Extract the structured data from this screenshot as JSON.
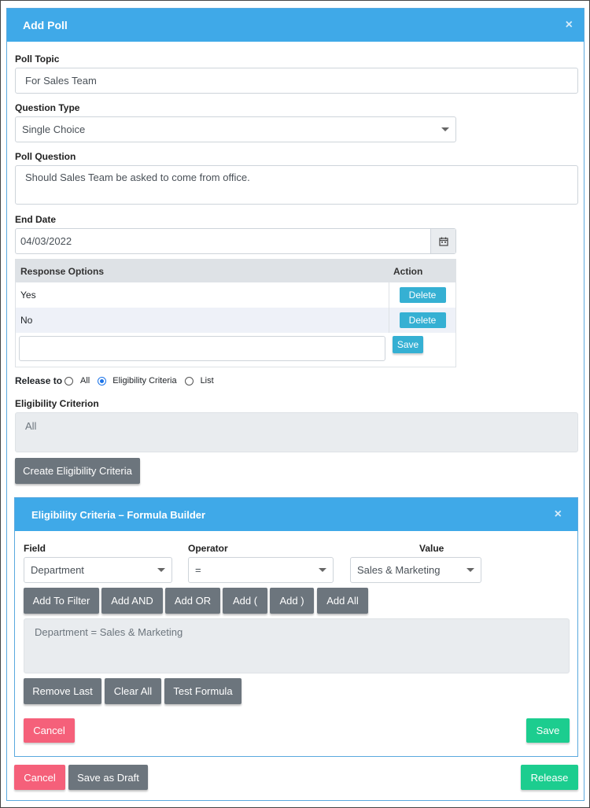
{
  "modal": {
    "title": "Add Poll",
    "close": "×"
  },
  "poll_topic": {
    "label": "Poll Topic",
    "value": "For Sales Team"
  },
  "question_type": {
    "label": "Question Type",
    "value": "Single Choice"
  },
  "poll_question": {
    "label": "Poll Question",
    "value": "Should Sales Team be asked to come from office."
  },
  "end_date": {
    "label": "End Date",
    "value": "04/03/2022"
  },
  "response_table": {
    "headers": [
      "Response Options",
      "Action"
    ],
    "rows": [
      {
        "option": "Yes",
        "action": "Delete"
      },
      {
        "option": "No",
        "action": "Delete"
      }
    ],
    "new_option_value": "",
    "save_label": "Save"
  },
  "release_to": {
    "label": "Release to",
    "options": [
      "All",
      "Eligibility Criteria",
      "List"
    ],
    "selected": "Eligibility Criteria"
  },
  "eligibility_criterion": {
    "label": "Eligibility Criterion",
    "value": "All"
  },
  "create_criteria_button": "Create Eligibility Criteria",
  "formula_builder": {
    "title": "Eligibility Criteria – Formula Builder",
    "close": "×",
    "field": {
      "label": "Field",
      "value": "Department"
    },
    "operator": {
      "label": "Operator",
      "value": "="
    },
    "value": {
      "label": "Value",
      "value": "Sales & Marketing"
    },
    "add_buttons": [
      "Add To Filter",
      "Add AND",
      "Add OR",
      "Add (",
      "Add )",
      "Add All"
    ],
    "formula": "Department = Sales & Marketing",
    "edit_buttons": [
      "Remove Last",
      "Clear All",
      "Test Formula"
    ],
    "cancel": "Cancel",
    "save": "Save"
  },
  "footer": {
    "cancel": "Cancel",
    "draft": "Save as Draft",
    "release": "Release"
  },
  "colors": {
    "header": "#3fa9e8",
    "grey_button": "#6c757d",
    "teal_button": "#35b0d3",
    "cancel": "#f5607a",
    "confirm": "#1ccd8f"
  }
}
